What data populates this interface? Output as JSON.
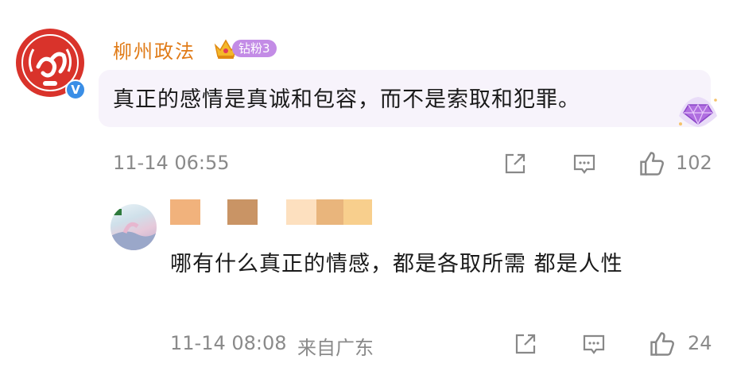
{
  "comment": {
    "author": "柳州政法",
    "fan_badge": "钻粉3",
    "verified_mark": "V",
    "text": "真正的感情是真诚和包容，而不是索取和犯罪。",
    "time": "11-14 06:55",
    "like_count": "102",
    "icons": [
      "crown-icon",
      "diamond-icon",
      "share-icon",
      "comment-icon",
      "like-icon"
    ]
  },
  "reply": {
    "author_pixelated": true,
    "text": "哪有什么真正的情感，都是各取所需 都是人性",
    "time": "11-14 08:08",
    "location": "来自广东",
    "like_count": "24"
  },
  "colors": {
    "author_name": "#e07b18",
    "fan_badge": "#c38ce6",
    "bubble_bg": "#f7f3fb",
    "avatar_red": "#d9332b",
    "verified_blue": "#3a8ee6",
    "meta_gray": "#8a8a8a"
  }
}
